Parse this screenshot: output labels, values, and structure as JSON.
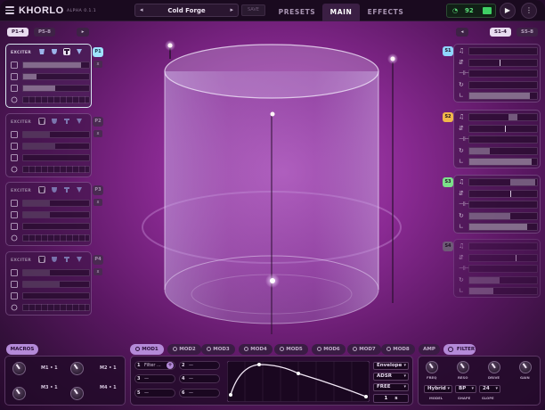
{
  "app": {
    "name": "KHORLO",
    "version": "ALPHA 0.1.1"
  },
  "header": {
    "preset_name": "Cold Forge",
    "prev_arrow": "◂",
    "next_arrow": "▸",
    "save_label": "SAVE",
    "tabs": [
      "PRESETS",
      "MAIN",
      "EFFECTS"
    ],
    "active_tab": "MAIN",
    "status_value": "92",
    "play_glyph": "▶",
    "more_glyph": "⋮"
  },
  "left": {
    "tabs": [
      "P1-4",
      "P5-8"
    ],
    "arrow": "▸",
    "cards": [
      {
        "label": "EXCITER",
        "badge": "P1",
        "active": true,
        "fills": [
          0.88,
          0.2,
          0.48
        ]
      },
      {
        "label": "EXCITER",
        "badge": "P2",
        "active": false,
        "fills": [
          0.4,
          0.48,
          0.0
        ]
      },
      {
        "label": "EXCITER",
        "badge": "P3",
        "active": false,
        "fills": [
          0.4,
          0.4,
          0.0
        ]
      },
      {
        "label": "EXCITER",
        "badge": "P4",
        "active": false,
        "fills": [
          0.4,
          0.55,
          0.0
        ]
      }
    ],
    "mini_labels": [
      "x",
      "x",
      "x",
      "x"
    ]
  },
  "right": {
    "tabs": [
      "S1-4",
      "S5-8"
    ],
    "arrow": "◂",
    "cards": [
      {
        "badge": "S1",
        "color": "#8fd6ff"
      },
      {
        "badge": "S2",
        "color": "#f0b84a"
      },
      {
        "badge": "S3",
        "color": "#7ce08a"
      },
      {
        "badge": "S4",
        "color": "#6e5a77"
      }
    ]
  },
  "macros": {
    "title": "MACROS",
    "items": [
      {
        "label": "M1 • 1"
      },
      {
        "label": "M2 • 1"
      },
      {
        "label": "M3 • 1"
      },
      {
        "label": "M4 • 1"
      }
    ]
  },
  "modulation": {
    "tabs": [
      "MOD1",
      "MOD2",
      "MOD3",
      "MOD4",
      "MOD5",
      "MOD6",
      "MOD7",
      "MOD8"
    ],
    "active": "MOD1",
    "slots": [
      {
        "num": "1",
        "label": "Filter ..."
      },
      {
        "num": "2",
        "label": "—"
      },
      {
        "num": "3",
        "label": "—"
      },
      {
        "num": "4",
        "label": "—"
      },
      {
        "num": "5",
        "label": "—"
      },
      {
        "num": "6",
        "label": "—"
      }
    ],
    "add_glyph": "+",
    "type": "Envelope",
    "shape": "ADSR",
    "mode": "FREE",
    "time_value": "1",
    "time_unit": "s"
  },
  "amp_tab": "AMP",
  "filter": {
    "tab": "FILTER",
    "knobs": [
      "FREQ",
      "RESO",
      "DRIVE",
      "GAIN"
    ],
    "model_value": "Hybrid",
    "model_label": "MODEL",
    "shape_value": "BP",
    "shape_label": "SHAPE",
    "slope_value": "24",
    "slope_label": "SLOPE"
  }
}
